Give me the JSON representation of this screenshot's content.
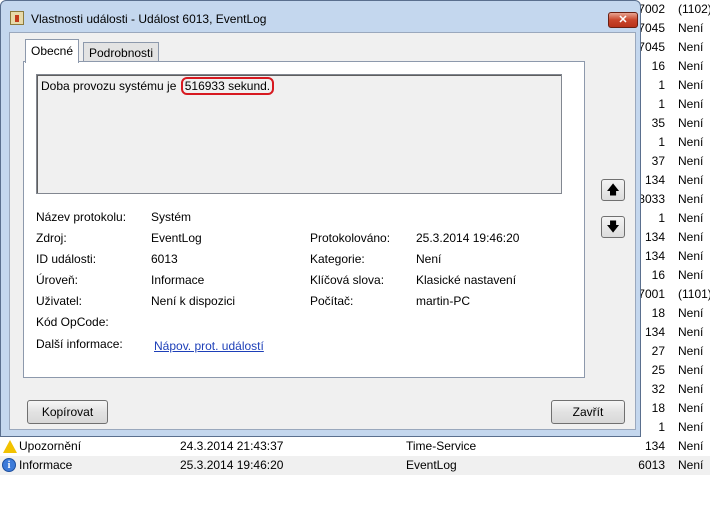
{
  "background_list": {
    "rows": [
      {
        "id": "7002",
        "category": "(1102)"
      },
      {
        "id": "7045",
        "category": "Není"
      },
      {
        "id": "7045",
        "category": "Není"
      },
      {
        "id": "16",
        "category": "Není"
      },
      {
        "id": "1",
        "category": "Není"
      },
      {
        "id": "1",
        "category": "Není"
      },
      {
        "id": "35",
        "category": "Není"
      },
      {
        "id": "1",
        "category": "Není"
      },
      {
        "id": "37",
        "category": "Není"
      },
      {
        "id": "134",
        "category": "Není"
      },
      {
        "id": "8033",
        "category": "Není"
      },
      {
        "id": "1",
        "category": "Není"
      },
      {
        "id": "134",
        "category": "Není"
      },
      {
        "id": "134",
        "category": "Není"
      },
      {
        "id": "16",
        "category": "Není"
      },
      {
        "id": "7001",
        "category": "(1101)"
      },
      {
        "id": "18",
        "category": "Není"
      },
      {
        "id": "134",
        "category": "Není"
      },
      {
        "id": "27",
        "category": "Není"
      },
      {
        "id": "25",
        "category": "Není"
      },
      {
        "id": "32",
        "category": "Není"
      },
      {
        "id": "18",
        "category": "Není"
      },
      {
        "id": "1",
        "category": "Není"
      }
    ],
    "bottom_rows": [
      {
        "level": "Upozornění",
        "date": "24.3.2014 21:43:37",
        "source": "Time-Service",
        "id": "134",
        "category": "Není"
      },
      {
        "level": "Informace",
        "date": "25.3.2014 19:46:20",
        "source": "EventLog",
        "id": "6013",
        "category": "Není"
      }
    ]
  },
  "dialog": {
    "title": "Vlastnosti události - Událost 6013, EventLog",
    "tabs": {
      "general": "Obecné",
      "details": "Podrobnosti"
    },
    "description_prefix": "Doba provozu systému je ",
    "description_highlight": "516933 sekund.",
    "fields": {
      "log_name_label": "Název protokolu:",
      "log_name": "Systém",
      "source_label": "Zdroj:",
      "source": "EventLog",
      "logged_label": "Protokolováno:",
      "logged": "25.3.2014 19:46:20",
      "event_id_label": "ID události:",
      "event_id": "6013",
      "task_label": "Kategorie:",
      "task": "Není",
      "level_label": "Úroveň:",
      "level": "Informace",
      "keywords_label": "Klíčová slova:",
      "keywords": "Klasické nastavení",
      "user_label": "Uživatel:",
      "user": "Není k dispozici",
      "computer_label": "Počítač:",
      "computer": "martin-PC",
      "opcode_label": "Kód OpCode:",
      "more_info_label": "Další informace:",
      "more_info_link": "Nápov. prot. událostí"
    },
    "buttons": {
      "copy": "Kopírovat",
      "close": "Zavřít",
      "up": "🡅",
      "down": "🡇",
      "title_close": "✕"
    }
  },
  "colors": {
    "highlight": "#d71920",
    "link": "#1d3fb8",
    "window_frame": "#c4d7ee"
  }
}
